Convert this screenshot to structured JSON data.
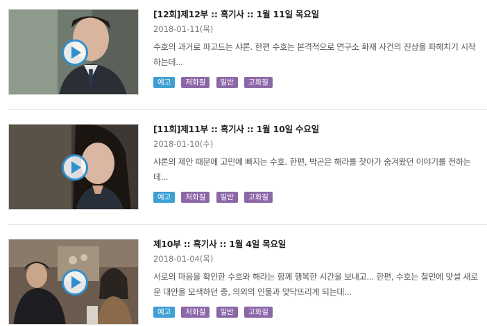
{
  "colors": {
    "accent_play": "#2f8fd0",
    "tag_preview": "#3d9fd3",
    "tag_quality": "#8c67a8"
  },
  "episodes": [
    {
      "title": "[12회]제12부 :: 흑기사 :: 1월 11일 목요일",
      "date": "2018-01-11(목)",
      "description": "수호의 과거로 파고드는 샤론. 한편 수호는 본격적으로 연구소 화재 사건의 진상을 파헤치기 시작하는데...",
      "tags": [
        "예고",
        "저화질",
        "일반",
        "고화질"
      ]
    },
    {
      "title": "[11회]제11부 :: 흑기사 :: 1월 10일 수요일",
      "date": "2018-01-10(수)",
      "description": "샤론의 제안 때문에 고민에 빠지는 수호. 한편, 박곤은 해라를 찾아가 숨겨왔던 이야기를 전하는데...",
      "tags": [
        "예고",
        "저화질",
        "일반",
        "고화질"
      ]
    },
    {
      "title": "제10부 :: 흑기사 :: 1월 4일 목요일",
      "date": "2018-01-04(목)",
      "description": "서로의 마음을 확인한 수호와 해라는 함께 행복한 시간을 보내고... 한편, 수호는 철민에 맞설 새로운 대안을 모색하던 중, 의외의 인물과 맞닥뜨리게 되는데...",
      "tags": [
        "예고",
        "저화질",
        "일반",
        "고화질"
      ]
    }
  ]
}
